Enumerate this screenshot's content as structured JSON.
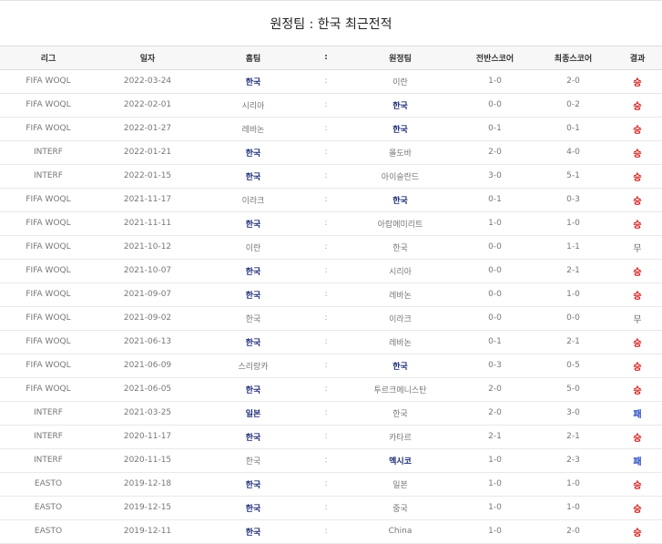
{
  "title": "원정팀 : 한국 최근전적",
  "headers": [
    "리그",
    "일자",
    "홈팀",
    ":",
    "원정팀",
    "전반스코어",
    "최종스코어",
    "결과"
  ],
  "rows": [
    {
      "league": "FIFA WOQL",
      "date": "2022-03-24",
      "home": "한국",
      "away": "이란",
      "half": "1-0",
      "final": "2-0",
      "result": "승",
      "win_side": "home",
      "res": "W"
    },
    {
      "league": "FIFA WOQL",
      "date": "2022-02-01",
      "home": "시리아",
      "away": "한국",
      "half": "0-0",
      "final": "0-2",
      "result": "승",
      "win_side": "away",
      "res": "W"
    },
    {
      "league": "FIFA WOQL",
      "date": "2022-01-27",
      "home": "레바논",
      "away": "한국",
      "half": "0-1",
      "final": "0-1",
      "result": "승",
      "win_side": "away",
      "res": "W"
    },
    {
      "league": "INTERF",
      "date": "2022-01-21",
      "home": "한국",
      "away": "몰도바",
      "half": "2-0",
      "final": "4-0",
      "result": "승",
      "win_side": "home",
      "res": "W"
    },
    {
      "league": "INTERF",
      "date": "2022-01-15",
      "home": "한국",
      "away": "아이슬란드",
      "half": "3-0",
      "final": "5-1",
      "result": "승",
      "win_side": "home",
      "res": "W"
    },
    {
      "league": "FIFA WOQL",
      "date": "2021-11-17",
      "home": "이라크",
      "away": "한국",
      "half": "0-1",
      "final": "0-3",
      "result": "승",
      "win_side": "away",
      "res": "W"
    },
    {
      "league": "FIFA WOQL",
      "date": "2021-11-11",
      "home": "한국",
      "away": "아랍에미리트",
      "half": "1-0",
      "final": "1-0",
      "result": "승",
      "win_side": "home",
      "res": "W"
    },
    {
      "league": "FIFA WOQL",
      "date": "2021-10-12",
      "home": "이란",
      "away": "한국",
      "half": "0-0",
      "final": "1-1",
      "result": "무",
      "win_side": "none",
      "res": "D"
    },
    {
      "league": "FIFA WOQL",
      "date": "2021-10-07",
      "home": "한국",
      "away": "시리아",
      "half": "0-0",
      "final": "2-1",
      "result": "승",
      "win_side": "home",
      "res": "W"
    },
    {
      "league": "FIFA WOQL",
      "date": "2021-09-07",
      "home": "한국",
      "away": "레바논",
      "half": "0-0",
      "final": "1-0",
      "result": "승",
      "win_side": "home",
      "res": "W"
    },
    {
      "league": "FIFA WOQL",
      "date": "2021-09-02",
      "home": "한국",
      "away": "이라크",
      "half": "0-0",
      "final": "0-0",
      "result": "무",
      "win_side": "none",
      "res": "D"
    },
    {
      "league": "FIFA WOQL",
      "date": "2021-06-13",
      "home": "한국",
      "away": "레바논",
      "half": "0-1",
      "final": "2-1",
      "result": "승",
      "win_side": "home",
      "res": "W"
    },
    {
      "league": "FIFA WOQL",
      "date": "2021-06-09",
      "home": "스리랑카",
      "away": "한국",
      "half": "0-3",
      "final": "0-5",
      "result": "승",
      "win_side": "away",
      "res": "W"
    },
    {
      "league": "FIFA WOQL",
      "date": "2021-06-05",
      "home": "한국",
      "away": "투르크메니스탄",
      "half": "2-0",
      "final": "5-0",
      "result": "승",
      "win_side": "home",
      "res": "W"
    },
    {
      "league": "INTERF",
      "date": "2021-03-25",
      "home": "일본",
      "away": "한국",
      "half": "2-0",
      "final": "3-0",
      "result": "패",
      "win_side": "home",
      "res": "L"
    },
    {
      "league": "INTERF",
      "date": "2020-11-17",
      "home": "한국",
      "away": "카타르",
      "half": "2-1",
      "final": "2-1",
      "result": "승",
      "win_side": "home",
      "res": "W"
    },
    {
      "league": "INTERF",
      "date": "2020-11-15",
      "home": "한국",
      "away": "멕시코",
      "half": "1-0",
      "final": "2-3",
      "result": "패",
      "win_side": "away",
      "res": "L"
    },
    {
      "league": "EASTO",
      "date": "2019-12-18",
      "home": "한국",
      "away": "일본",
      "half": "1-0",
      "final": "1-0",
      "result": "승",
      "win_side": "home",
      "res": "W"
    },
    {
      "league": "EASTO",
      "date": "2019-12-15",
      "home": "한국",
      "away": "중국",
      "half": "1-0",
      "final": "1-0",
      "result": "승",
      "win_side": "home",
      "res": "W"
    },
    {
      "league": "EASTO",
      "date": "2019-12-11",
      "home": "한국",
      "away": "China",
      "half": "1-0",
      "final": "2-0",
      "result": "승",
      "win_side": "home",
      "res": "W"
    }
  ],
  "colors": {
    "win": "#d01818",
    "loss": "#2146c0",
    "draw": "#666666",
    "winner_team": "#1f2d78"
  }
}
